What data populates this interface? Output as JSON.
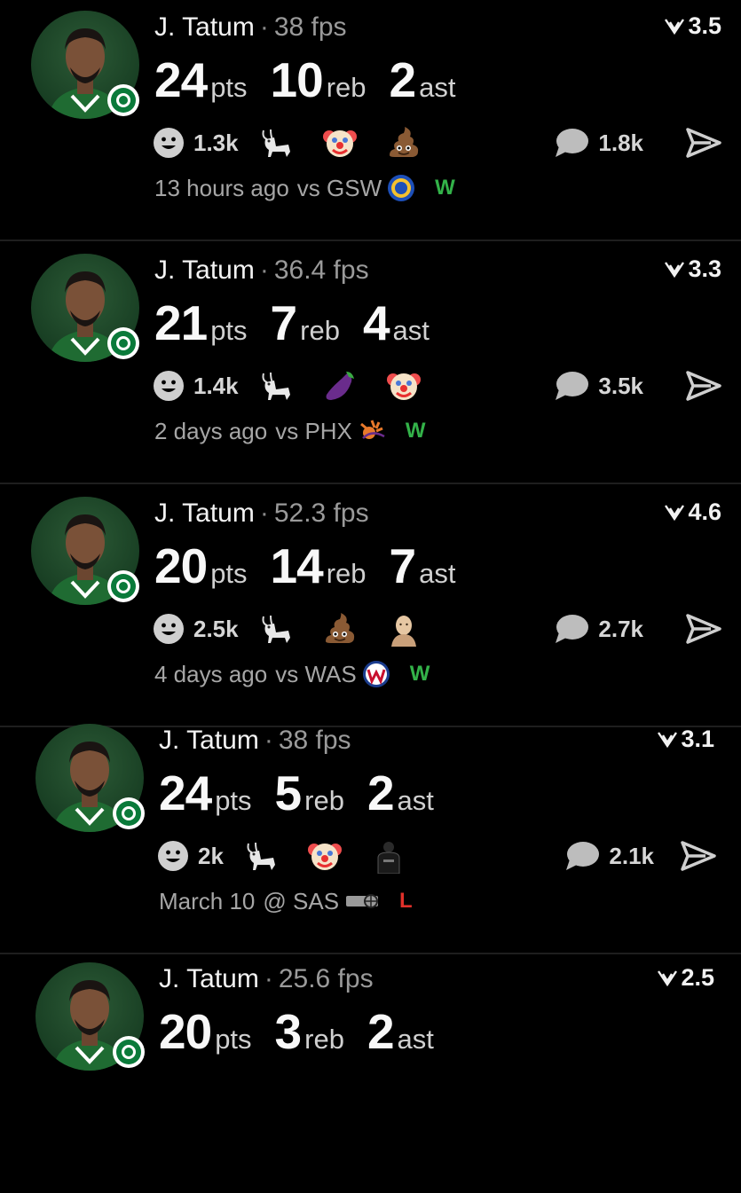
{
  "colors": {
    "win": "#33b249",
    "loss": "#e0302a",
    "background": "#000000",
    "muted": "#9a9a9a"
  },
  "feed": [
    {
      "player": "J. Tatum",
      "separator": "·",
      "fps": "38 fps",
      "score": "3.5",
      "pts": "24",
      "pts_label": "pts",
      "reb": "10",
      "reb_label": "reb",
      "ast": "2",
      "ast_label": "ast",
      "reactions_count": "1.3k",
      "emojis": [
        "goat-emoji",
        "clown-emoji",
        "poop-emoji"
      ],
      "comments_count": "1.8k",
      "time": "13 hours ago",
      "opponent": "vs GSW",
      "opponent_logo": "warriors-logo-icon",
      "result": "W"
    },
    {
      "player": "J. Tatum",
      "separator": "·",
      "fps": "36.4 fps",
      "score": "3.3",
      "pts": "21",
      "pts_label": "pts",
      "reb": "7",
      "reb_label": "reb",
      "ast": "4",
      "ast_label": "ast",
      "reactions_count": "1.4k",
      "emojis": [
        "goat-emoji",
        "eggplant-emoji",
        "clown-emoji"
      ],
      "comments_count": "3.5k",
      "time": "2 days ago",
      "opponent": "vs PHX",
      "opponent_logo": "suns-logo-icon",
      "result": "W"
    },
    {
      "player": "J. Tatum",
      "separator": "·",
      "fps": "52.3 fps",
      "score": "4.6",
      "pts": "20",
      "pts_label": "pts",
      "reb": "14",
      "reb_label": "reb",
      "ast": "7",
      "ast_label": "ast",
      "reactions_count": "2.5k",
      "emojis": [
        "goat-emoji",
        "poop-emoji",
        "bald-man-emoji"
      ],
      "comments_count": "2.7k",
      "time": "4 days ago",
      "opponent": "vs WAS",
      "opponent_logo": "wizards-logo-icon",
      "result": "W"
    },
    {
      "player": "J. Tatum",
      "separator": "·",
      "fps": "38 fps",
      "score": "3.1",
      "pts": "24",
      "pts_label": "pts",
      "reb": "5",
      "reb_label": "reb",
      "ast": "2",
      "ast_label": "ast",
      "reactions_count": "2k",
      "emojis": [
        "goat-emoji",
        "clown-emoji",
        "nets-jersey-emoji"
      ],
      "comments_count": "2.1k",
      "time": "March 10",
      "opponent": "@ SAS",
      "opponent_logo": "spurs-logo-icon",
      "result": "L"
    },
    {
      "player": "J. Tatum",
      "separator": "·",
      "fps": "25.6 fps",
      "score": "2.5",
      "pts": "20",
      "pts_label": "pts",
      "reb": "3",
      "reb_label": "reb",
      "ast": "2",
      "ast_label": "ast"
    }
  ]
}
